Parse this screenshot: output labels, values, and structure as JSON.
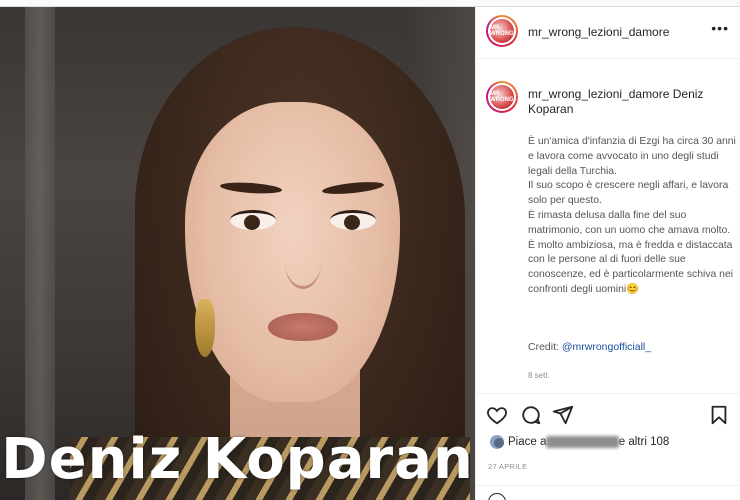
{
  "post": {
    "photo_caption": "Deniz Koparan"
  },
  "header": {
    "username": "mr_wrong_lezioni_damore",
    "more_label": "•••",
    "avatar_text": "MR WRONG"
  },
  "caption": {
    "username": "mr_wrong_lezioni_damore",
    "title": "Deniz Koparan",
    "body": "È un'amica d'infanzia di Ezgi ha circa 30 anni e lavora come avvocato in uno degli studi legali della Turchia.\nIl suo scopo è crescere negli affari, e lavora solo per questo.\nÈ rimasta delusa dalla fine del suo matrimonio, con un uomo che amava molto. È molto ambiziosa, ma è fredda e distaccata con le persone al di fuori delle sue conoscenze, ed è particolarmente schiva nei confronti degli uomini😊",
    "credit_prefix": "Credit: ",
    "credit_link": "@mrwrongofficiall_",
    "time_ago": "8 sett."
  },
  "actions": {
    "like_icon": "heart-icon",
    "comment_icon": "comment-icon",
    "share_icon": "paper-plane-icon",
    "save_icon": "bookmark-icon"
  },
  "likes": {
    "prefix": "Piace a ",
    "user": "frizzafederica",
    "suffix": " e altri 108"
  },
  "date": "27 APRILE"
}
